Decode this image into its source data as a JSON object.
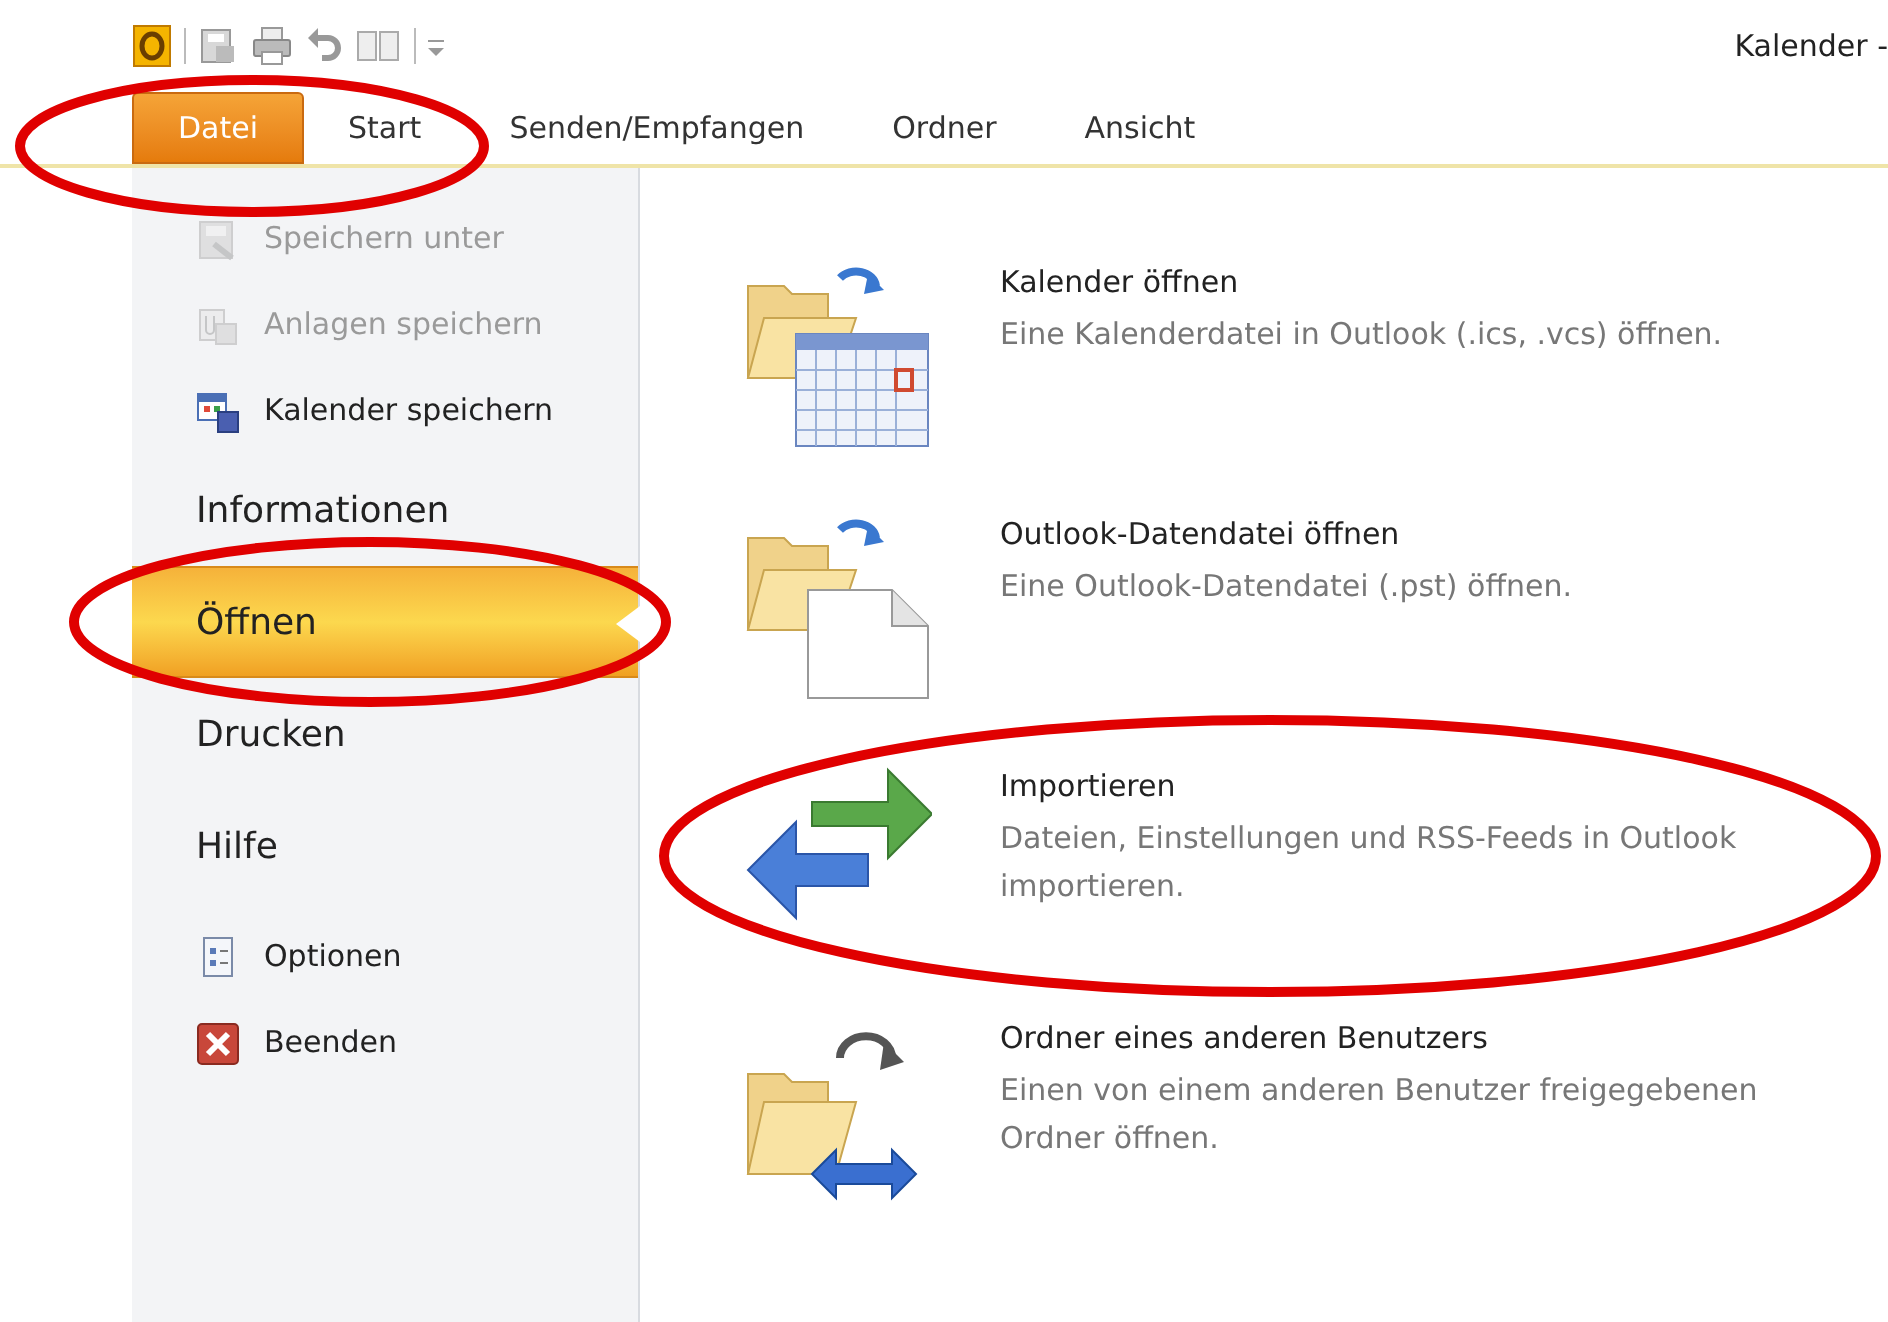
{
  "window": {
    "title": "Kalender -"
  },
  "tabs": [
    {
      "label": "Datei",
      "selected": true
    },
    {
      "label": "Start",
      "selected": false
    },
    {
      "label": "Senden/Empfangen",
      "selected": false
    },
    {
      "label": "Ordner",
      "selected": false
    },
    {
      "label": "Ansicht",
      "selected": false
    }
  ],
  "sidebar": {
    "items": [
      {
        "kind": "command",
        "label": "Speichern unter",
        "disabled": true,
        "selected": false
      },
      {
        "kind": "command",
        "label": "Anlagen speichern",
        "disabled": true,
        "selected": false
      },
      {
        "kind": "command",
        "label": "Kalender speichern",
        "disabled": false,
        "selected": false
      },
      {
        "kind": "section",
        "label": "Informationen",
        "disabled": false,
        "selected": false
      },
      {
        "kind": "section",
        "label": "Öffnen",
        "disabled": false,
        "selected": true
      },
      {
        "kind": "section",
        "label": "Drucken",
        "disabled": false,
        "selected": false
      },
      {
        "kind": "section",
        "label": "Hilfe",
        "disabled": false,
        "selected": false
      },
      {
        "kind": "command",
        "label": "Optionen",
        "disabled": false,
        "selected": false
      },
      {
        "kind": "command",
        "label": "Beenden",
        "disabled": false,
        "selected": false
      }
    ]
  },
  "options": [
    {
      "title": "Kalender öffnen",
      "description": "Eine Kalenderdatei in Outlook (.ics, .vcs) öffnen."
    },
    {
      "title": "Outlook-Datendatei öffnen",
      "description": "Eine Outlook-Datendatei (.pst) öffnen."
    },
    {
      "title": "Importieren",
      "description": "Dateien, Einstellungen und RSS-Feeds in Outlook importieren."
    },
    {
      "title": "Ordner eines anderen Benutzers",
      "description": "Einen von einem anderen Benutzer freigegebenen Ordner öffnen."
    }
  ],
  "annotations": [
    {
      "kind": "ellipse",
      "color": "#e00000"
    },
    {
      "kind": "ellipse",
      "color": "#e00000"
    },
    {
      "kind": "ellipse",
      "color": "#e00000"
    }
  ]
}
